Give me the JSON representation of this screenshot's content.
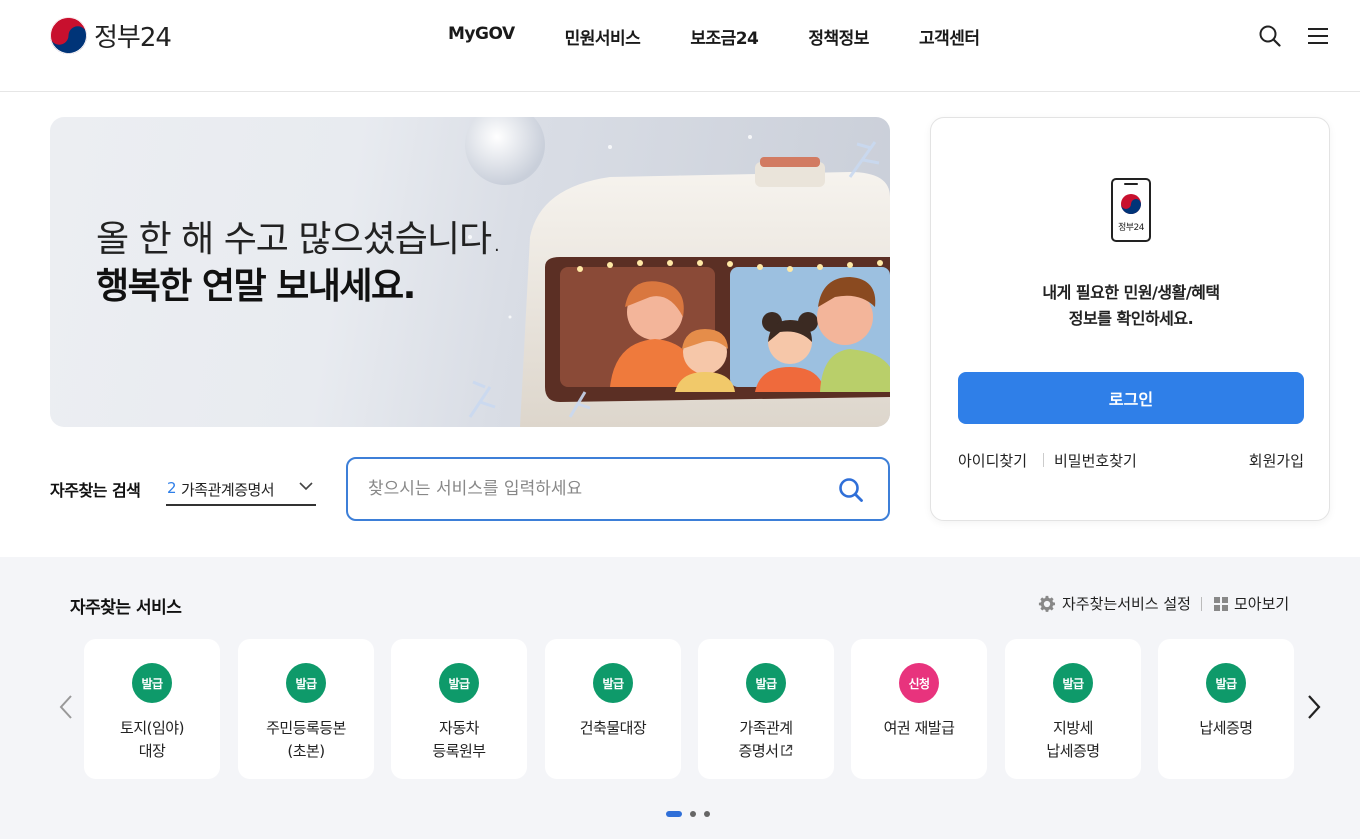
{
  "header": {
    "logo_text": "정부24",
    "nav": [
      "MyGOV",
      "민원서비스",
      "보조금24",
      "정책정보",
      "고객센터"
    ],
    "search_icon": "search-icon",
    "menu_icon": "hamburger-menu-icon"
  },
  "banner": {
    "line1": "올 한 해 수고 많으셨습니다.",
    "line2": "행복한 연말 보내세요."
  },
  "login": {
    "phone_label": "정부24",
    "message_line1": "내게 필요한 민원/생활/혜택",
    "message_line2": "정보를 확인하세요.",
    "button": "로그인",
    "find_id": "아이디찾기",
    "find_pw": "비밀번호찾기",
    "signup": "회원가입"
  },
  "search": {
    "label": "자주찾는 검색",
    "select_rank": "2",
    "select_text": "가족관계증명서",
    "placeholder": "찾으시는 서비스를 입력하세요"
  },
  "services": {
    "title": "자주찾는 서비스",
    "setting_label": "자주찾는서비스 설정",
    "view_all_label": "모아보기",
    "cards": [
      {
        "badge": "발급",
        "line1": "토지(임야)",
        "line2": "대장",
        "color": "#0e9a6a"
      },
      {
        "badge": "발급",
        "line1": "주민등록등본",
        "line2": "(초본)",
        "color": "#0e9a6a"
      },
      {
        "badge": "발급",
        "line1": "자동차",
        "line2": "등록원부",
        "color": "#0e9a6a"
      },
      {
        "badge": "발급",
        "line1": "건축물대장",
        "line2": "",
        "color": "#0e9a6a"
      },
      {
        "badge": "발급",
        "line1": "가족관계",
        "line2": "증명서",
        "color": "#0e9a6a",
        "external": true
      },
      {
        "badge": "신청",
        "line1": "여권 재발급",
        "line2": "",
        "color": "#e8337d"
      },
      {
        "badge": "발급",
        "line1": "지방세",
        "line2": "납세증명",
        "color": "#0e9a6a"
      },
      {
        "badge": "발급",
        "line1": "납세증명",
        "line2": "",
        "color": "#0e9a6a"
      }
    ],
    "pagination": {
      "current": 1,
      "total": 3
    }
  },
  "colors": {
    "primary": "#2f7fe8",
    "issue_badge": "#0e9a6a",
    "apply_badge": "#e8337d",
    "section_bg": "#f4f5f8"
  }
}
